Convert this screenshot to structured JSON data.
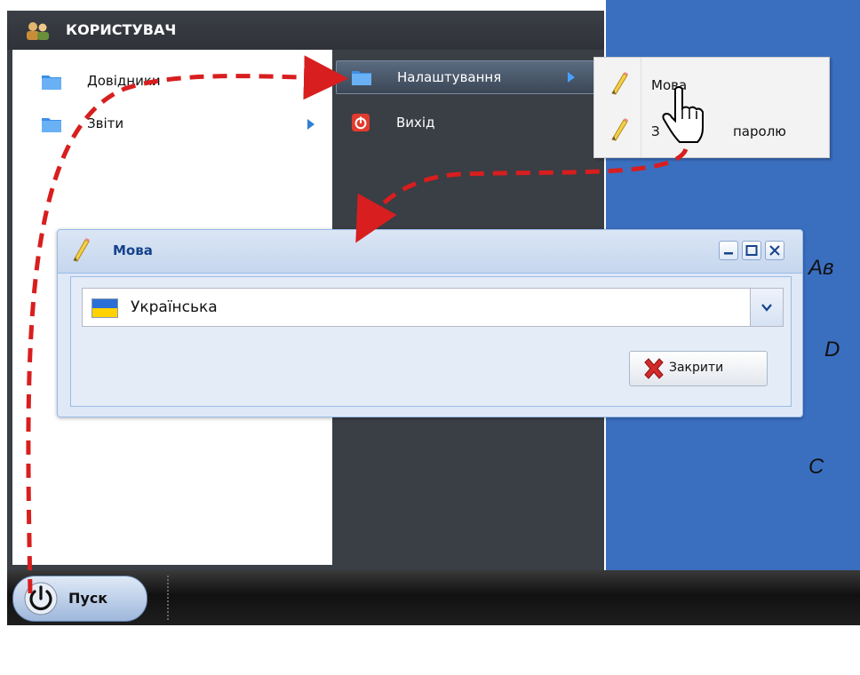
{
  "start_menu": {
    "header_title": "КОРИСТУВАЧ",
    "left_items": [
      {
        "label": "Довідники",
        "icon": "folder-icon"
      },
      {
        "label": "Звіти",
        "icon": "folder-icon"
      }
    ],
    "right_items": [
      {
        "label": "Налаштування",
        "icon": "folder-icon"
      },
      {
        "label": "Вихід",
        "icon": "power-icon"
      }
    ]
  },
  "settings_submenu": {
    "items": [
      {
        "label": "Мова",
        "icon": "pencil-icon"
      },
      {
        "label_left": "З",
        "label_right": "паролю",
        "icon": "pencil-icon"
      }
    ]
  },
  "dialog": {
    "title": "Мова",
    "language_value": "Українська",
    "close_label": "Закрити"
  },
  "desktop_text": [
    "Ав",
    "D",
    "C"
  ],
  "taskbar": {
    "start_label": "Пуск"
  },
  "colors": {
    "desktop": "#3a6fc0",
    "menu_dark": "#3a3e45",
    "dialog_bg": "#dfe8f6",
    "dialog_title": "#15428b",
    "annotation_arrow": "#d81e1e"
  }
}
